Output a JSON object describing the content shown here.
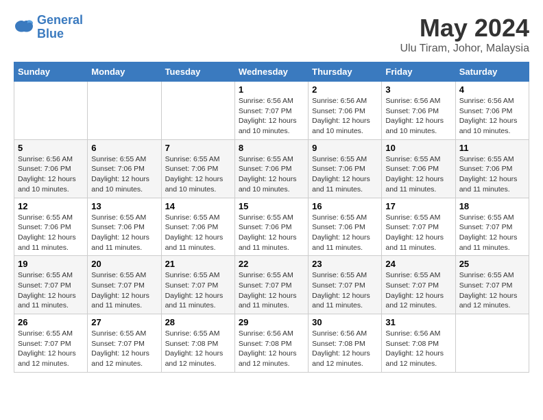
{
  "logo": {
    "line1": "General",
    "line2": "Blue"
  },
  "title": "May 2024",
  "subtitle": "Ulu Tiram, Johor, Malaysia",
  "headers": [
    "Sunday",
    "Monday",
    "Tuesday",
    "Wednesday",
    "Thursday",
    "Friday",
    "Saturday"
  ],
  "weeks": [
    [
      {
        "day": "",
        "info": ""
      },
      {
        "day": "",
        "info": ""
      },
      {
        "day": "",
        "info": ""
      },
      {
        "day": "1",
        "info": "Sunrise: 6:56 AM\nSunset: 7:07 PM\nDaylight: 12 hours\nand 10 minutes."
      },
      {
        "day": "2",
        "info": "Sunrise: 6:56 AM\nSunset: 7:06 PM\nDaylight: 12 hours\nand 10 minutes."
      },
      {
        "day": "3",
        "info": "Sunrise: 6:56 AM\nSunset: 7:06 PM\nDaylight: 12 hours\nand 10 minutes."
      },
      {
        "day": "4",
        "info": "Sunrise: 6:56 AM\nSunset: 7:06 PM\nDaylight: 12 hours\nand 10 minutes."
      }
    ],
    [
      {
        "day": "5",
        "info": "Sunrise: 6:56 AM\nSunset: 7:06 PM\nDaylight: 12 hours\nand 10 minutes."
      },
      {
        "day": "6",
        "info": "Sunrise: 6:55 AM\nSunset: 7:06 PM\nDaylight: 12 hours\nand 10 minutes."
      },
      {
        "day": "7",
        "info": "Sunrise: 6:55 AM\nSunset: 7:06 PM\nDaylight: 12 hours\nand 10 minutes."
      },
      {
        "day": "8",
        "info": "Sunrise: 6:55 AM\nSunset: 7:06 PM\nDaylight: 12 hours\nand 10 minutes."
      },
      {
        "day": "9",
        "info": "Sunrise: 6:55 AM\nSunset: 7:06 PM\nDaylight: 12 hours\nand 11 minutes."
      },
      {
        "day": "10",
        "info": "Sunrise: 6:55 AM\nSunset: 7:06 PM\nDaylight: 12 hours\nand 11 minutes."
      },
      {
        "day": "11",
        "info": "Sunrise: 6:55 AM\nSunset: 7:06 PM\nDaylight: 12 hours\nand 11 minutes."
      }
    ],
    [
      {
        "day": "12",
        "info": "Sunrise: 6:55 AM\nSunset: 7:06 PM\nDaylight: 12 hours\nand 11 minutes."
      },
      {
        "day": "13",
        "info": "Sunrise: 6:55 AM\nSunset: 7:06 PM\nDaylight: 12 hours\nand 11 minutes."
      },
      {
        "day": "14",
        "info": "Sunrise: 6:55 AM\nSunset: 7:06 PM\nDaylight: 12 hours\nand 11 minutes."
      },
      {
        "day": "15",
        "info": "Sunrise: 6:55 AM\nSunset: 7:06 PM\nDaylight: 12 hours\nand 11 minutes."
      },
      {
        "day": "16",
        "info": "Sunrise: 6:55 AM\nSunset: 7:06 PM\nDaylight: 12 hours\nand 11 minutes."
      },
      {
        "day": "17",
        "info": "Sunrise: 6:55 AM\nSunset: 7:07 PM\nDaylight: 12 hours\nand 11 minutes."
      },
      {
        "day": "18",
        "info": "Sunrise: 6:55 AM\nSunset: 7:07 PM\nDaylight: 12 hours\nand 11 minutes."
      }
    ],
    [
      {
        "day": "19",
        "info": "Sunrise: 6:55 AM\nSunset: 7:07 PM\nDaylight: 12 hours\nand 11 minutes."
      },
      {
        "day": "20",
        "info": "Sunrise: 6:55 AM\nSunset: 7:07 PM\nDaylight: 12 hours\nand 11 minutes."
      },
      {
        "day": "21",
        "info": "Sunrise: 6:55 AM\nSunset: 7:07 PM\nDaylight: 12 hours\nand 11 minutes."
      },
      {
        "day": "22",
        "info": "Sunrise: 6:55 AM\nSunset: 7:07 PM\nDaylight: 12 hours\nand 11 minutes."
      },
      {
        "day": "23",
        "info": "Sunrise: 6:55 AM\nSunset: 7:07 PM\nDaylight: 12 hours\nand 11 minutes."
      },
      {
        "day": "24",
        "info": "Sunrise: 6:55 AM\nSunset: 7:07 PM\nDaylight: 12 hours\nand 12 minutes."
      },
      {
        "day": "25",
        "info": "Sunrise: 6:55 AM\nSunset: 7:07 PM\nDaylight: 12 hours\nand 12 minutes."
      }
    ],
    [
      {
        "day": "26",
        "info": "Sunrise: 6:55 AM\nSunset: 7:07 PM\nDaylight: 12 hours\nand 12 minutes."
      },
      {
        "day": "27",
        "info": "Sunrise: 6:55 AM\nSunset: 7:07 PM\nDaylight: 12 hours\nand 12 minutes."
      },
      {
        "day": "28",
        "info": "Sunrise: 6:55 AM\nSunset: 7:08 PM\nDaylight: 12 hours\nand 12 minutes."
      },
      {
        "day": "29",
        "info": "Sunrise: 6:56 AM\nSunset: 7:08 PM\nDaylight: 12 hours\nand 12 minutes."
      },
      {
        "day": "30",
        "info": "Sunrise: 6:56 AM\nSunset: 7:08 PM\nDaylight: 12 hours\nand 12 minutes."
      },
      {
        "day": "31",
        "info": "Sunrise: 6:56 AM\nSunset: 7:08 PM\nDaylight: 12 hours\nand 12 minutes."
      },
      {
        "day": "",
        "info": ""
      }
    ]
  ]
}
